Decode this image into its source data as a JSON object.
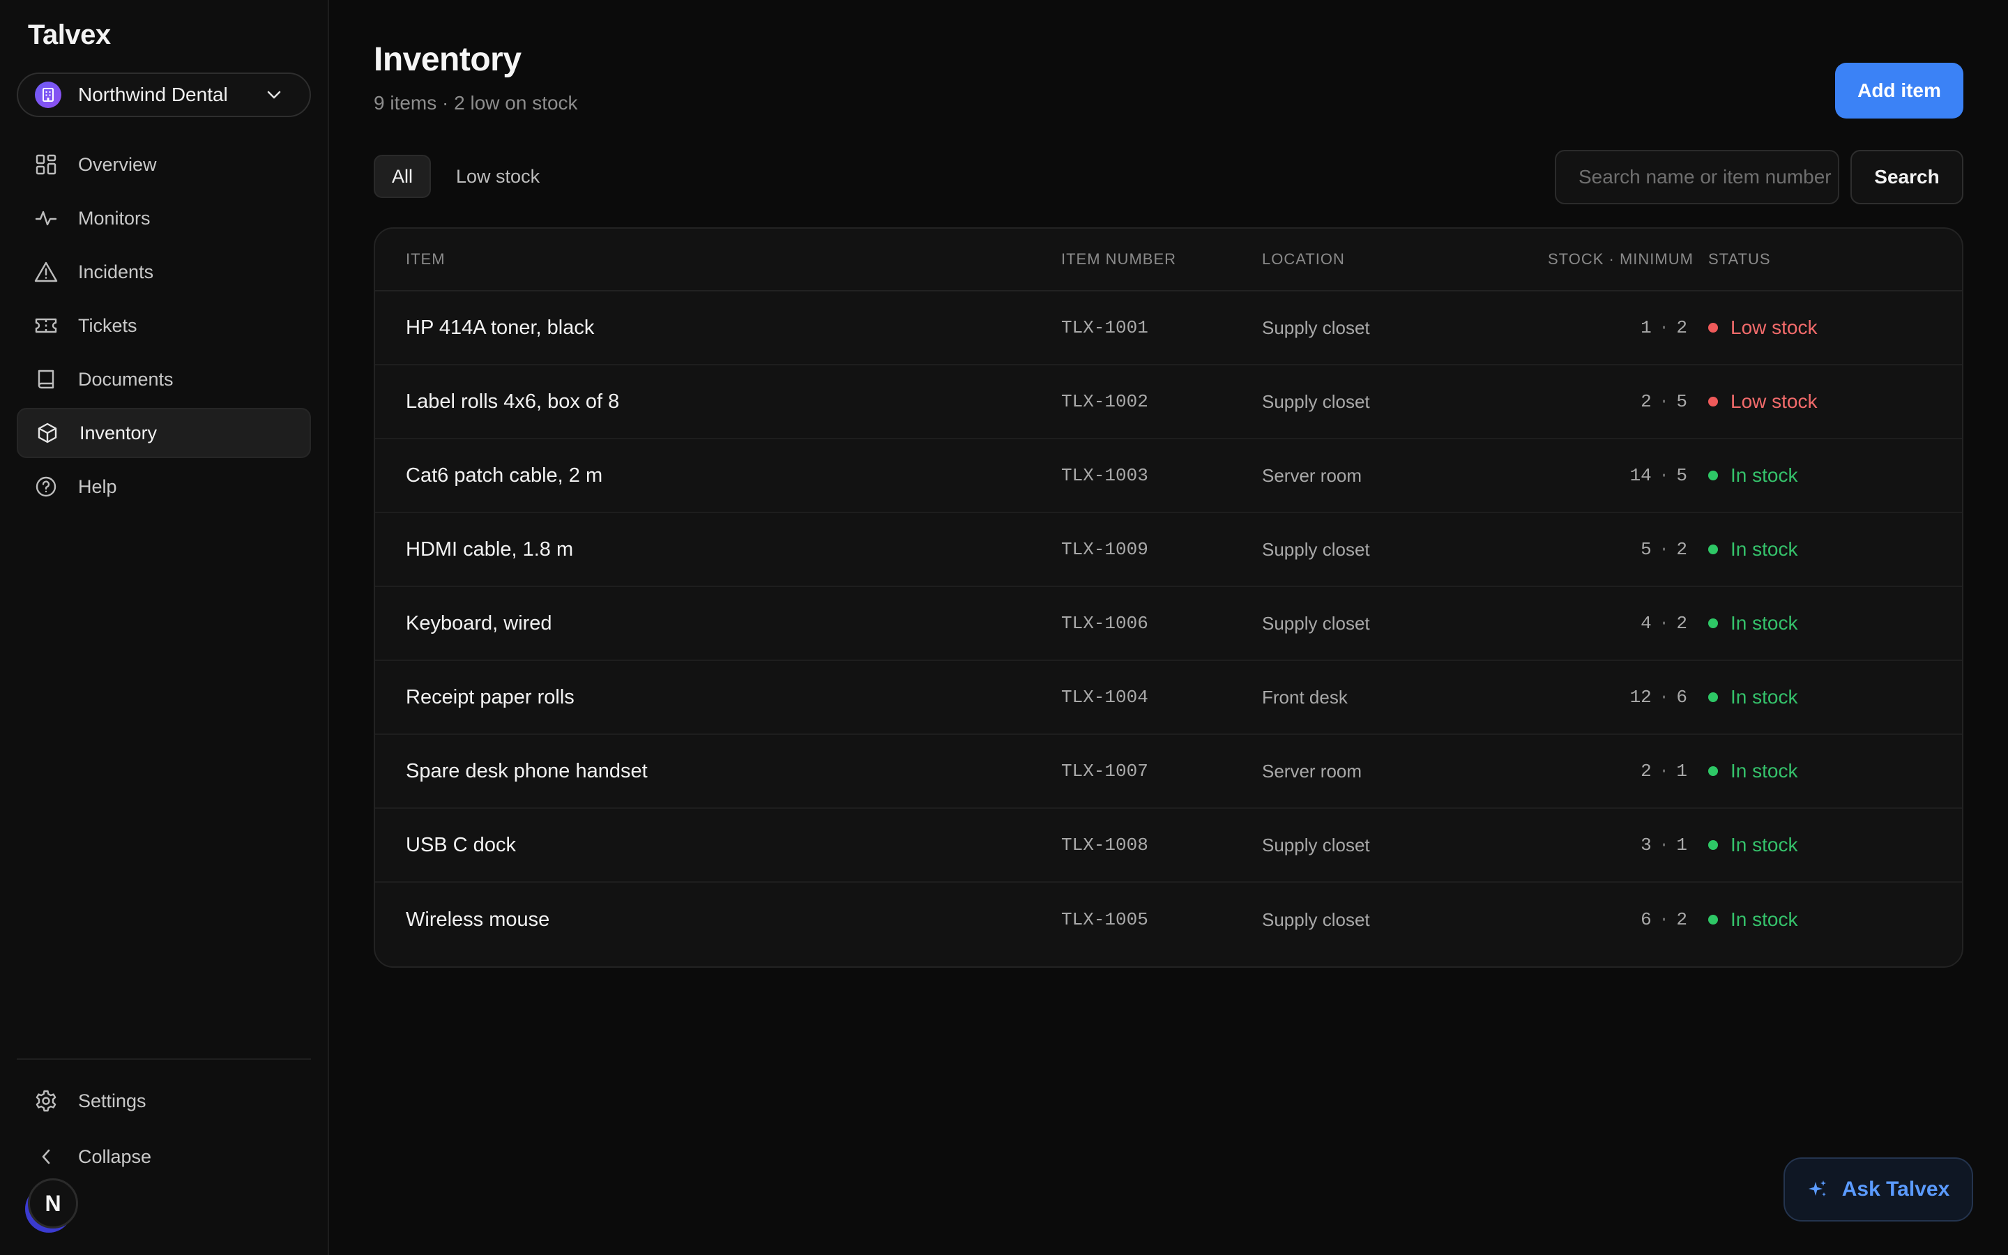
{
  "app": {
    "name": "Talvex"
  },
  "org_switcher": {
    "name": "Northwind Dental"
  },
  "sidebar": {
    "items": [
      {
        "label": "Overview",
        "icon": "grid-icon"
      },
      {
        "label": "Monitors",
        "icon": "pulse-icon"
      },
      {
        "label": "Incidents",
        "icon": "warning-icon"
      },
      {
        "label": "Tickets",
        "icon": "ticket-icon"
      },
      {
        "label": "Documents",
        "icon": "book-icon"
      },
      {
        "label": "Inventory",
        "icon": "box-icon",
        "active": true
      },
      {
        "label": "Help",
        "icon": "help-icon"
      }
    ],
    "bottom": {
      "settings": "Settings",
      "collapse": "Collapse"
    },
    "user_initial": "N"
  },
  "page": {
    "title": "Inventory",
    "subtitle": "9 items · 2 low on stock",
    "add_button": "Add item"
  },
  "filters": {
    "all": "All",
    "low_stock": "Low stock",
    "active": "All"
  },
  "search": {
    "placeholder": "Search name or item number",
    "button": "Search"
  },
  "table": {
    "headers": {
      "item": "Item",
      "item_number": "Item number",
      "location": "Location",
      "stock": "Stock · minimum",
      "status": "Status"
    },
    "rows": [
      {
        "item": "HP 414A toner, black",
        "number": "TLX-1001",
        "location": "Supply closet",
        "stock": "1",
        "minimum": "2",
        "status": "Low stock",
        "level": "low"
      },
      {
        "item": "Label rolls 4x6, box of 8",
        "number": "TLX-1002",
        "location": "Supply closet",
        "stock": "2",
        "minimum": "5",
        "status": "Low stock",
        "level": "low"
      },
      {
        "item": "Cat6 patch cable, 2 m",
        "number": "TLX-1003",
        "location": "Server room",
        "stock": "14",
        "minimum": "5",
        "status": "In stock",
        "level": "in"
      },
      {
        "item": "HDMI cable, 1.8 m",
        "number": "TLX-1009",
        "location": "Supply closet",
        "stock": "5",
        "minimum": "2",
        "status": "In stock",
        "level": "in"
      },
      {
        "item": "Keyboard, wired",
        "number": "TLX-1006",
        "location": "Supply closet",
        "stock": "4",
        "minimum": "2",
        "status": "In stock",
        "level": "in"
      },
      {
        "item": "Receipt paper rolls",
        "number": "TLX-1004",
        "location": "Front desk",
        "stock": "12",
        "minimum": "6",
        "status": "In stock",
        "level": "in"
      },
      {
        "item": "Spare desk phone handset",
        "number": "TLX-1007",
        "location": "Server room",
        "stock": "2",
        "minimum": "1",
        "status": "In stock",
        "level": "in"
      },
      {
        "item": "USB C dock",
        "number": "TLX-1008",
        "location": "Supply closet",
        "stock": "3",
        "minimum": "1",
        "status": "In stock",
        "level": "in"
      },
      {
        "item": "Wireless mouse",
        "number": "TLX-1005",
        "location": "Supply closet",
        "stock": "6",
        "minimum": "2",
        "status": "In stock",
        "level": "in"
      }
    ]
  },
  "assistant": {
    "label": "Ask Talvex",
    "icon": "sparkle-icon"
  },
  "colors": {
    "accent": "#3b82f6",
    "low": "#ef5a5a",
    "in": "#2ec866",
    "assistant_text": "#5b9bff"
  }
}
